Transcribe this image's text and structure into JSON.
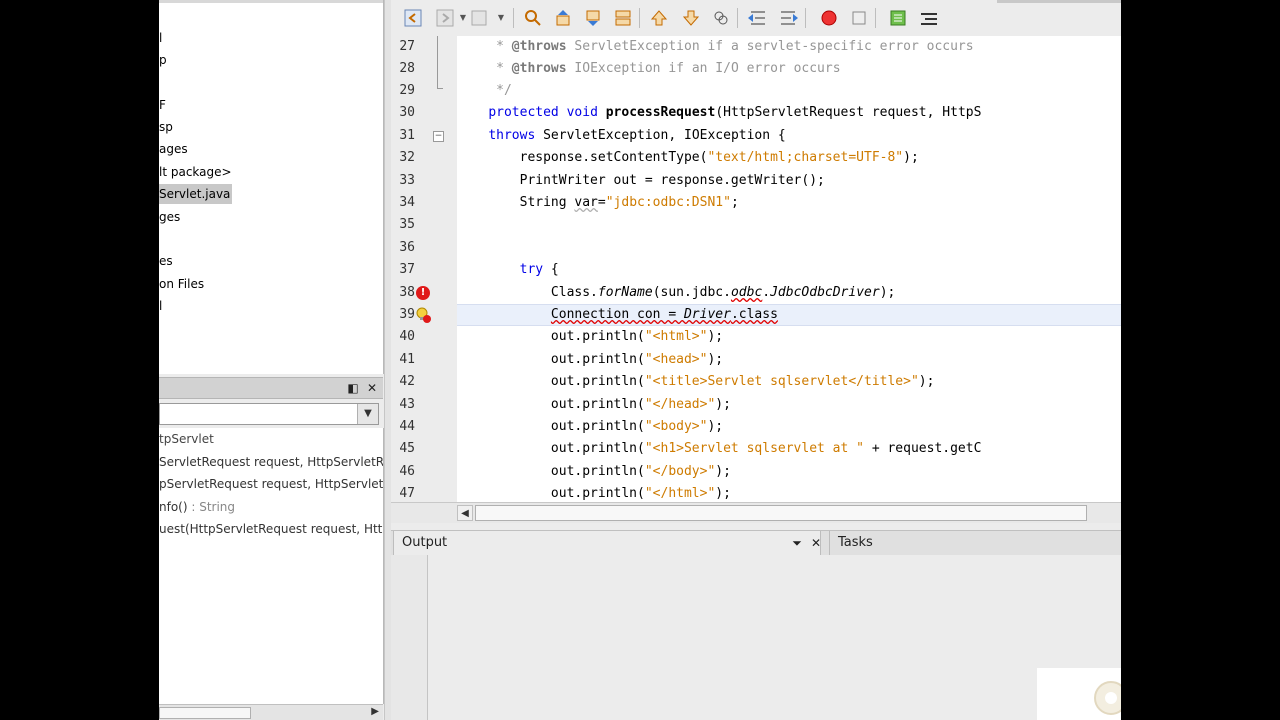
{
  "project_tree": {
    "items": [
      {
        "label": "l"
      },
      {
        "label": "p"
      },
      {
        "label": "F"
      },
      {
        "label": "sp"
      },
      {
        "label": "ages"
      },
      {
        "label": "lt package>"
      },
      {
        "label": "Servlet.java"
      },
      {
        "label": "ges"
      },
      {
        "label": "es"
      },
      {
        "label": "on Files"
      },
      {
        "label": "l"
      }
    ]
  },
  "navigator": {
    "items": [
      {
        "label": "tpServlet",
        "type": ""
      },
      {
        "label": "ServletRequest request, HttpServletR",
        "type": ""
      },
      {
        "label": "pServletRequest request, HttpServletI",
        "type": ""
      },
      {
        "label": "nfo()",
        "type": " : String"
      },
      {
        "label": "uest(HttpServletRequest request, Htt",
        "type": ""
      }
    ]
  },
  "editor": {
    "line_numbers": [
      "27",
      "28",
      "29",
      "30",
      "31",
      "32",
      "33",
      "34",
      "35",
      "36",
      "37",
      "38",
      "39",
      "40",
      "41",
      "42",
      "43",
      "44",
      "45",
      "46",
      "47"
    ],
    "lines": {
      "l27a": "     * ",
      "l27b": "@throws",
      "l27c": " ServletException if a servlet-specific error occurs",
      "l28a": "     * ",
      "l28b": "@throws",
      "l28c": " IOException if an I/O error occurs",
      "l29": "     */",
      "l30a": "    ",
      "l30b": "protected",
      "l30c": " ",
      "l30d": "void",
      "l30e": " ",
      "l30f": "processRequest",
      "l30g": "(HttpServletRequest request, HttpS",
      "l31a": "    ",
      "l31b": "throws",
      "l31c": " ServletException, IOException {",
      "l32a": "        response.setContentType(",
      "l32b": "\"text/html;charset=UTF-8\"",
      "l32c": ");",
      "l33": "        PrintWriter out = response.getWriter();",
      "l34a": "        String ",
      "l34b": "var",
      "l34c": "=",
      "l34d": "\"jdbc:odbc:DSN1\"",
      "l34e": ";",
      "l37a": "        ",
      "l37b": "try",
      "l37c": " {",
      "l38a": "            Class.",
      "l38b": "forName",
      "l38c": "(sun.jdbc.",
      "l38d": "odbc",
      "l38e": ".",
      "l38f": "JdbcOdbcDriver",
      "l38g": ");",
      "l39a": "            ",
      "l39b": "Connection con = ",
      "l39c": "Driver",
      "l39d": ".class",
      "l40a": "            out.println(",
      "l40b": "\"<html>\"",
      "l40c": ");",
      "l41a": "            out.println(",
      "l41b": "\"<head>\"",
      "l41c": ");",
      "l42a": "            out.println(",
      "l42b": "\"<title>Servlet sqlservlet</title>\"",
      "l42c": ");",
      "l43a": "            out.println(",
      "l43b": "\"</head>\"",
      "l43c": ");",
      "l44a": "            out.println(",
      "l44b": "\"<body>\"",
      "l44c": ");",
      "l45a": "            out.println(",
      "l45b": "\"<h1>Servlet sqlservlet at \"",
      "l45c": " + request.getC",
      "l46a": "            out.println(",
      "l46b": "\"</body>\"",
      "l46c": ");",
      "l47a": "            out.println(",
      "l47b": "\"</html>\"",
      "l47c": ");"
    }
  },
  "output_panel": {
    "tab_output": "Output",
    "tab_tasks": "Tasks"
  },
  "colors": {
    "keyword": "#0000e6",
    "string": "#ce7b00",
    "comment": "#969696",
    "error": "#e01919"
  }
}
